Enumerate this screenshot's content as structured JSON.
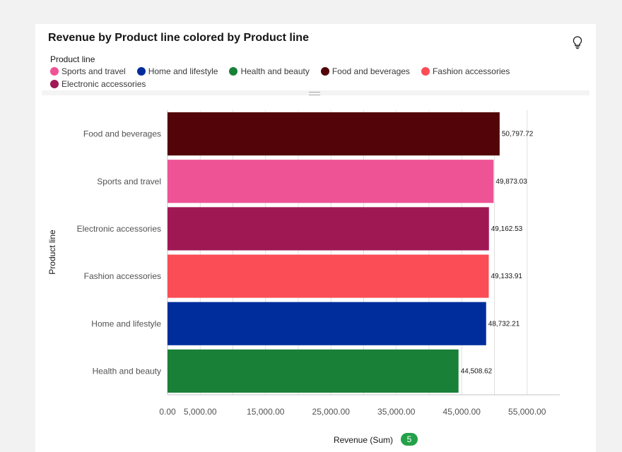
{
  "header": {
    "title": "Revenue by Product line colored by Product line",
    "hint_icon": "lightbulb-icon"
  },
  "legend": {
    "title": "Product line",
    "items": [
      {
        "label": "Sports and travel",
        "color": "#ee5396"
      },
      {
        "label": "Home and lifestyle",
        "color": "#002d9c"
      },
      {
        "label": "Health and beauty",
        "color": "#198038"
      },
      {
        "label": "Food and beverages",
        "color": "#520408"
      },
      {
        "label": "Fashion accessories",
        "color": "#fa4d56"
      },
      {
        "label": "Electronic accessories",
        "color": "#9f1853"
      }
    ]
  },
  "axis_badge": "5",
  "chart_data": {
    "type": "bar",
    "orientation": "horizontal",
    "categories": [
      "Food and beverages",
      "Sports and travel",
      "Electronic accessories",
      "Fashion accessories",
      "Home and lifestyle",
      "Health and beauty"
    ],
    "values": [
      50797.72,
      49873.03,
      49162.53,
      49133.91,
      48732.21,
      44508.62
    ],
    "value_labels": [
      "50,797.72",
      "49,873.03",
      "49,162.53",
      "49,133.91",
      "48,732.21",
      "44,508.62"
    ],
    "colors": [
      "#520408",
      "#ee5396",
      "#9f1853",
      "#fa4d56",
      "#002d9c",
      "#198038"
    ],
    "xlabel": "Revenue (Sum)",
    "ylabel": "Product line",
    "xlim": [
      0,
      60000
    ],
    "gridlines": [
      5000,
      10000,
      15000,
      20000,
      25000,
      30000,
      35000,
      40000,
      45000,
      50000,
      55000
    ],
    "ticks": [
      {
        "value": 0,
        "label": "0.00"
      },
      {
        "value": 5000,
        "label": "5,000.00"
      },
      {
        "value": 15000,
        "label": "15,000.00"
      },
      {
        "value": 25000,
        "label": "25,000.00"
      },
      {
        "value": 35000,
        "label": "35,000.00"
      },
      {
        "value": 45000,
        "label": "45,000.00"
      },
      {
        "value": 55000,
        "label": "55,000.00"
      }
    ],
    "grid": true
  }
}
